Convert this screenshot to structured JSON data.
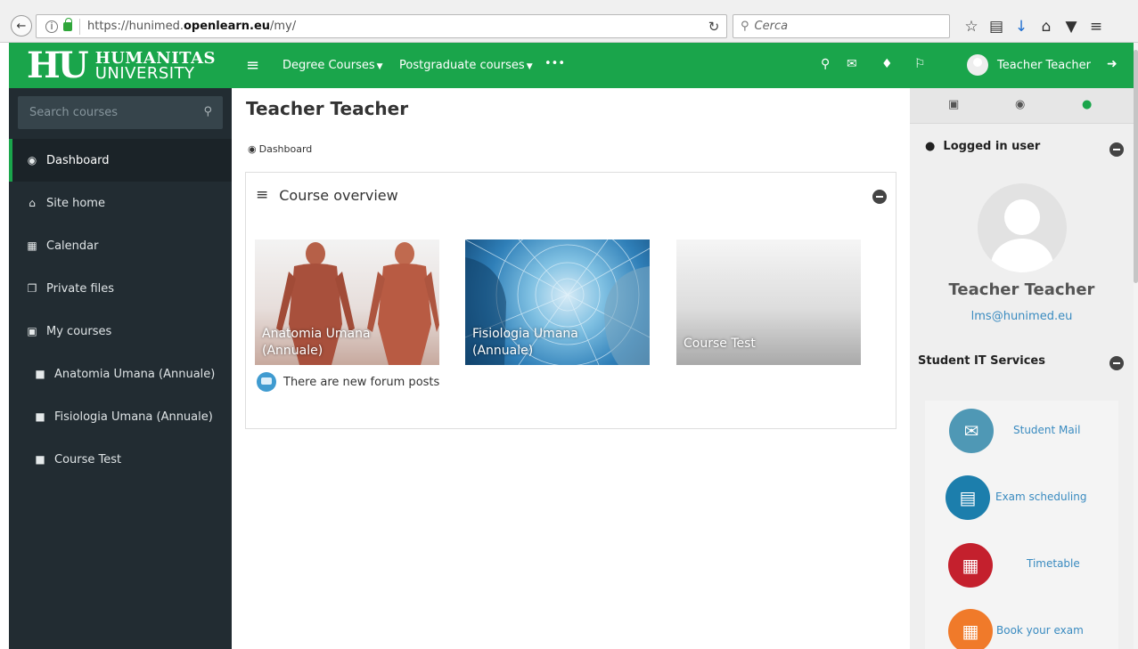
{
  "browser": {
    "url_prefix": "https://hunimed.",
    "url_domain": "openlearn.eu",
    "url_path": "/my/",
    "search_placeholder": "Cerca"
  },
  "header": {
    "logo_mark": "HU",
    "logo_line1": "HUMANITAS",
    "logo_line2": "UNIVERSITY",
    "nav": [
      {
        "label": "Degree Courses"
      },
      {
        "label": "Postgraduate courses"
      },
      {
        "label": "•••"
      }
    ],
    "user_name": "Teacher Teacher",
    "accent_color": "#1aa54b"
  },
  "sidebar": {
    "search_placeholder": "Search courses",
    "items": [
      {
        "label": "Dashboard",
        "icon": "dashboard-icon"
      },
      {
        "label": "Site home",
        "icon": "home-icon"
      },
      {
        "label": "Calendar",
        "icon": "calendar-icon"
      },
      {
        "label": "Private files",
        "icon": "files-icon"
      },
      {
        "label": "My courses",
        "icon": "book-icon"
      },
      {
        "label": "Anatomia Umana (Annuale)",
        "icon": "folder-icon"
      },
      {
        "label": "Fisiologia Umana (Annuale)",
        "icon": "folder-icon"
      },
      {
        "label": "Course Test",
        "icon": "folder-icon"
      }
    ]
  },
  "main": {
    "page_title": "Teacher Teacher",
    "breadcrumb": "Dashboard",
    "overview_title": "Course overview",
    "courses": [
      {
        "line1": "Anatomia Umana",
        "line2": "(Annuale)"
      },
      {
        "line1": "Fisiologia Umana",
        "line2": "(Annuale)"
      },
      {
        "line1": "Course Test",
        "line2": ""
      }
    ],
    "forum_notice": "There are new forum posts"
  },
  "right": {
    "logged_in_title": "Logged in user",
    "full_name": "Teacher Teacher",
    "email": "lms@hunimed.eu",
    "it_title": "Student IT Services",
    "services": [
      {
        "label": "Student Mail",
        "color": "#4f98b5",
        "icon": "mail-icon"
      },
      {
        "label": "Exam scheduling",
        "color": "#1c7eac",
        "icon": "document-icon"
      },
      {
        "label": "Timetable",
        "color": "#c4202d",
        "icon": "calendar-icon"
      },
      {
        "label": "Book your exam",
        "color": "#f07a2a",
        "icon": "clipboard-icon"
      }
    ]
  }
}
